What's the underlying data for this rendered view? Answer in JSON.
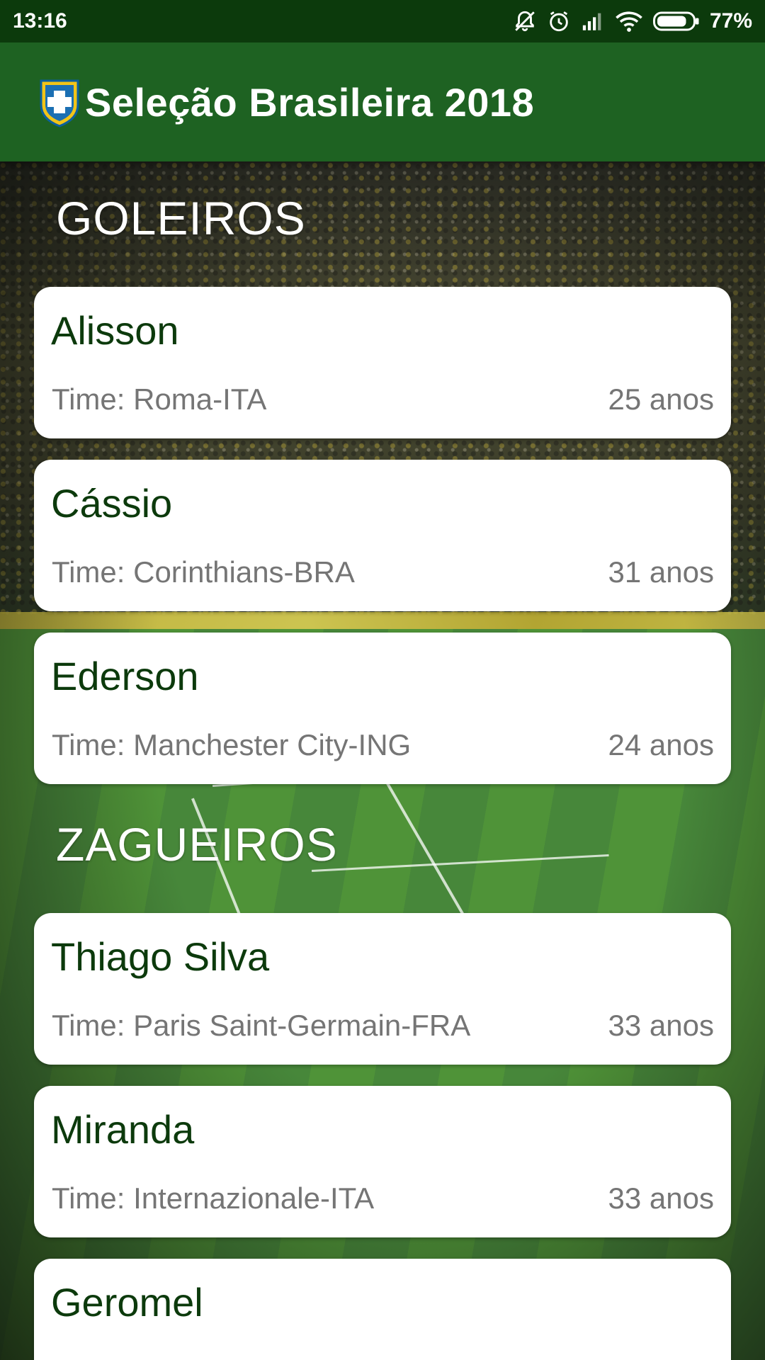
{
  "status_bar": {
    "time": "13:16",
    "battery": "77%",
    "icons": [
      "notifications-off-icon",
      "alarm-icon",
      "signal-icon",
      "wifi-icon",
      "battery-icon"
    ]
  },
  "app_bar": {
    "title": "Seleção Brasileira 2018",
    "logo": "cbf-crest-icon",
    "color": "#1e6222"
  },
  "sections": [
    {
      "title": "GOLEIROS",
      "players": [
        {
          "name": "Alisson",
          "team": "Time: Roma-ITA",
          "age": "25 anos"
        },
        {
          "name": "Cássio",
          "team": "Time: Corinthians-BRA",
          "age": "31 anos"
        },
        {
          "name": "Ederson",
          "team": "Time: Manchester City-ING",
          "age": "24 anos"
        }
      ]
    },
    {
      "title": "ZAGUEIROS",
      "players": [
        {
          "name": "Thiago Silva",
          "team": "Time: Paris Saint-Germain-FRA",
          "age": "33 anos"
        },
        {
          "name": "Miranda",
          "team": "Time: Internazionale-ITA",
          "age": "33 anos"
        },
        {
          "name": "Geromel",
          "team": "",
          "age": ""
        }
      ]
    }
  ],
  "colors": {
    "status_bar": "#0c3a0c",
    "player_name": "#0c3a0c",
    "secondary_text": "#757575",
    "card": "#ffffff"
  }
}
